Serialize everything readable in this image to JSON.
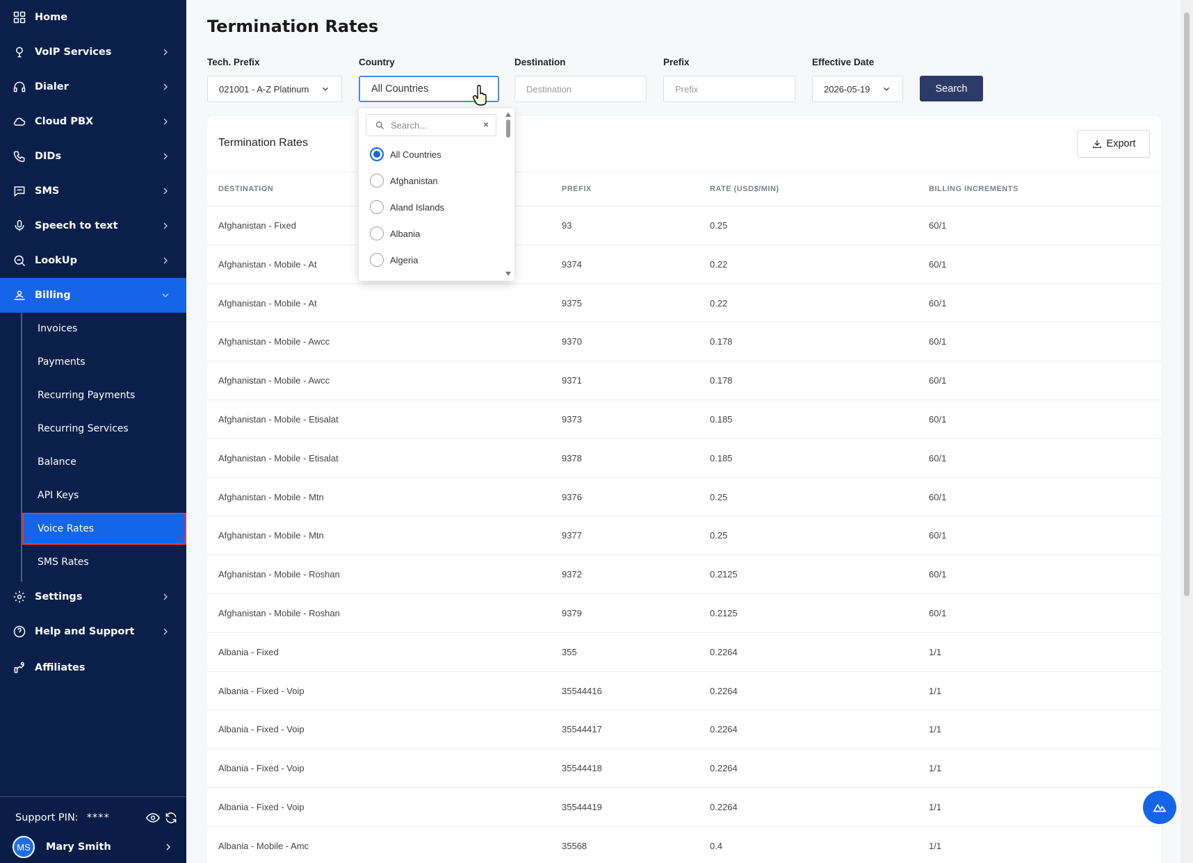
{
  "sidebar": {
    "nav": [
      {
        "label": "Home",
        "icon": "grid-icon",
        "chevron": false
      },
      {
        "label": "VoIP Services",
        "icon": "voip-icon",
        "chevron": true
      },
      {
        "label": "Dialer",
        "icon": "headset-icon",
        "chevron": true
      },
      {
        "label": "Cloud PBX",
        "icon": "cloud-icon",
        "chevron": true
      },
      {
        "label": "DIDs",
        "icon": "phone-icon",
        "chevron": true
      },
      {
        "label": "SMS",
        "icon": "chat-icon",
        "chevron": true
      },
      {
        "label": "Speech to text",
        "icon": "microphone-icon",
        "chevron": true
      },
      {
        "label": "LookUp",
        "icon": "lookup-icon",
        "chevron": true
      },
      {
        "label": "Billing",
        "icon": "billing-icon",
        "chevron": true,
        "expanded": true
      }
    ],
    "billing_sub": [
      "Invoices",
      "Payments",
      "Recurring Payments",
      "Recurring Services",
      "Balance",
      "API Keys",
      "Voice Rates",
      "SMS Rates"
    ],
    "selected_sub": "Voice Rates",
    "nav_after": [
      {
        "label": "Settings",
        "icon": "gear-icon",
        "chevron": true
      },
      {
        "label": "Help and Support",
        "icon": "help-icon",
        "chevron": true
      },
      {
        "label": "Affiliates",
        "icon": "affiliates-icon",
        "chevron": false
      }
    ],
    "support_pin_label": "Support PIN:",
    "support_pin_value": "****",
    "user_initials": "MS",
    "user_name": "Mary Smith"
  },
  "page": {
    "title": "Termination Rates"
  },
  "filters": {
    "tech_prefix_label": "Tech. Prefix",
    "tech_prefix_value": "021001 - A-Z Platinum",
    "country_label": "Country",
    "country_value": "All Countries",
    "destination_label": "Destination",
    "destination_placeholder": "Destination",
    "prefix_label": "Prefix",
    "prefix_placeholder": "Prefix",
    "effective_date_label": "Effective Date",
    "effective_date_value": "2026-05-19",
    "search_button": "Search"
  },
  "country_dropdown": {
    "search_placeholder": "Search...",
    "clear": "×",
    "options": [
      "All Countries",
      "Afghanistan",
      "Aland Islands",
      "Albania",
      "Algeria"
    ],
    "selected": "All Countries"
  },
  "table": {
    "title": "Termination Rates",
    "export_label": "Export",
    "columns": [
      "DESTINATION",
      "PREFIX",
      "RATE (USD$/MIN)",
      "BILLING INCREMENTS"
    ],
    "rows": [
      [
        "Afghanistan - Fixed",
        "93",
        "0.25",
        "60/1"
      ],
      [
        "Afghanistan - Mobile - At",
        "9374",
        "0.22",
        "60/1"
      ],
      [
        "Afghanistan - Mobile - At",
        "9375",
        "0.22",
        "60/1"
      ],
      [
        "Afghanistan - Mobile - Awcc",
        "9370",
        "0.178",
        "60/1"
      ],
      [
        "Afghanistan - Mobile - Awcc",
        "9371",
        "0.178",
        "60/1"
      ],
      [
        "Afghanistan - Mobile - Etisalat",
        "9373",
        "0.185",
        "60/1"
      ],
      [
        "Afghanistan - Mobile - Etisalat",
        "9378",
        "0.185",
        "60/1"
      ],
      [
        "Afghanistan - Mobile - Mtn",
        "9376",
        "0.25",
        "60/1"
      ],
      [
        "Afghanistan - Mobile - Mtn",
        "9377",
        "0.25",
        "60/1"
      ],
      [
        "Afghanistan - Mobile - Roshan",
        "9372",
        "0.2125",
        "60/1"
      ],
      [
        "Afghanistan - Mobile - Roshan",
        "9379",
        "0.2125",
        "60/1"
      ],
      [
        "Albania - Fixed",
        "355",
        "0.2264",
        "1/1"
      ],
      [
        "Albania - Fixed - Voip",
        "35544416",
        "0.2264",
        "1/1"
      ],
      [
        "Albania - Fixed - Voip",
        "35544417",
        "0.2264",
        "1/1"
      ],
      [
        "Albania - Fixed - Voip",
        "35544418",
        "0.2264",
        "1/1"
      ],
      [
        "Albania - Fixed - Voip",
        "35544419",
        "0.2264",
        "1/1"
      ],
      [
        "Albania - Mobile - Amc",
        "35568",
        "0.4",
        "1/1"
      ]
    ]
  },
  "colors": {
    "sidebar_bg": "#0b1f4b",
    "accent": "#1565e8",
    "search_button_bg": "#2b3a67",
    "highlight_outline": "#e53935"
  }
}
